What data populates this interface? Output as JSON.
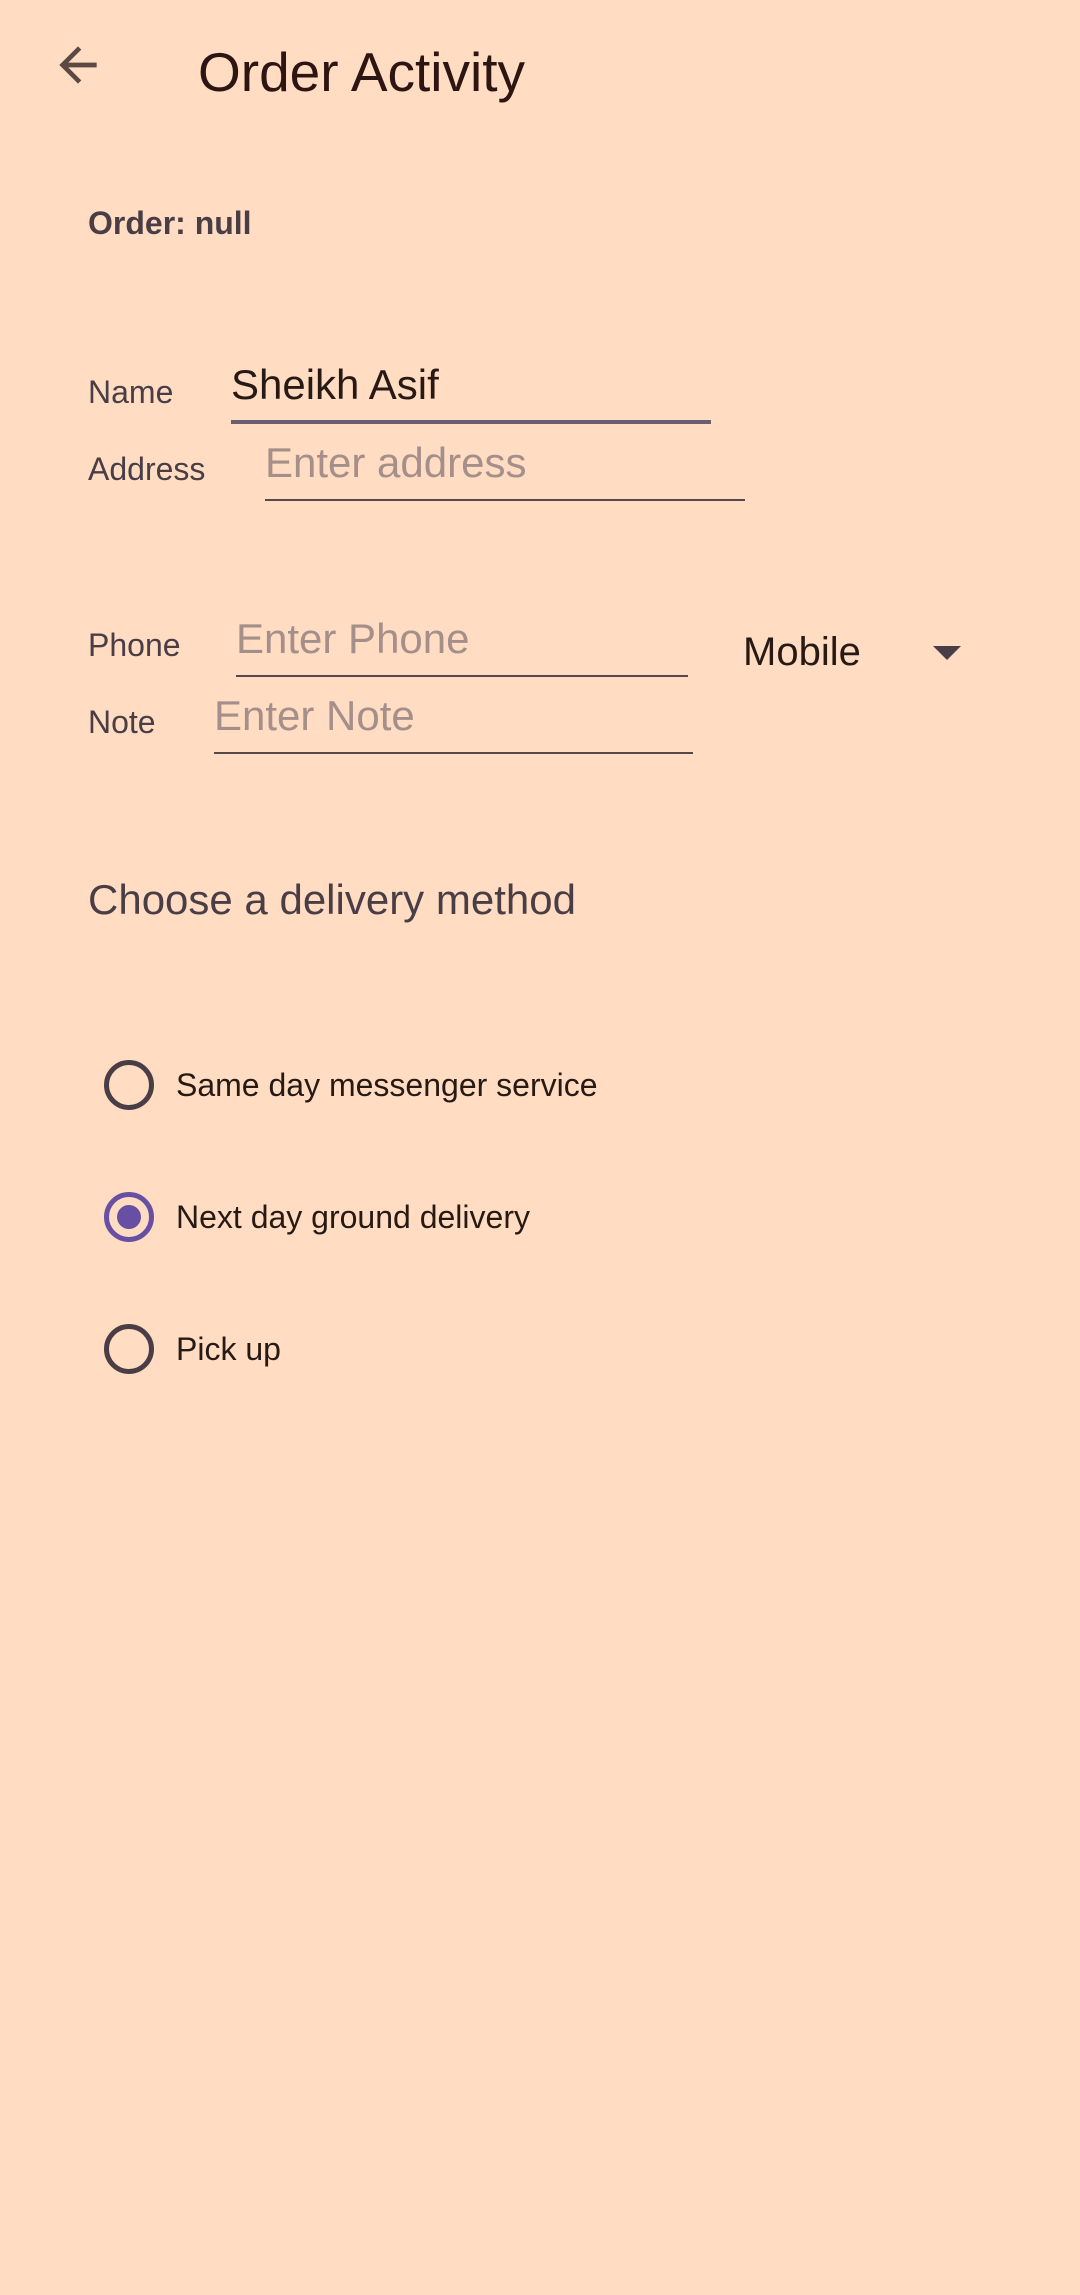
{
  "app_bar": {
    "title": "Order Activity",
    "back_icon": "arrow-back-icon"
  },
  "order": {
    "label": "Order: null"
  },
  "form": {
    "name": {
      "label": "Name",
      "value": "Sheikh Asif",
      "placeholder": ""
    },
    "address": {
      "label": "Address",
      "value": "",
      "placeholder": "Enter address"
    },
    "phone": {
      "label": "Phone",
      "value": "",
      "placeholder": "Enter Phone"
    },
    "phone_type": {
      "selected": "Mobile",
      "icon": "dropdown-arrow-icon"
    },
    "note": {
      "label": "Note",
      "value": "",
      "placeholder": "Enter Note"
    }
  },
  "delivery": {
    "heading": "Choose a delivery method",
    "options": [
      {
        "label": "Same day messenger service",
        "checked": false
      },
      {
        "label": "Next day ground delivery",
        "checked": true
      },
      {
        "label": "Pick up",
        "checked": false
      }
    ]
  },
  "colors": {
    "background": "#FFDCC2",
    "accent": "#6750a4",
    "text": "#271a14"
  }
}
